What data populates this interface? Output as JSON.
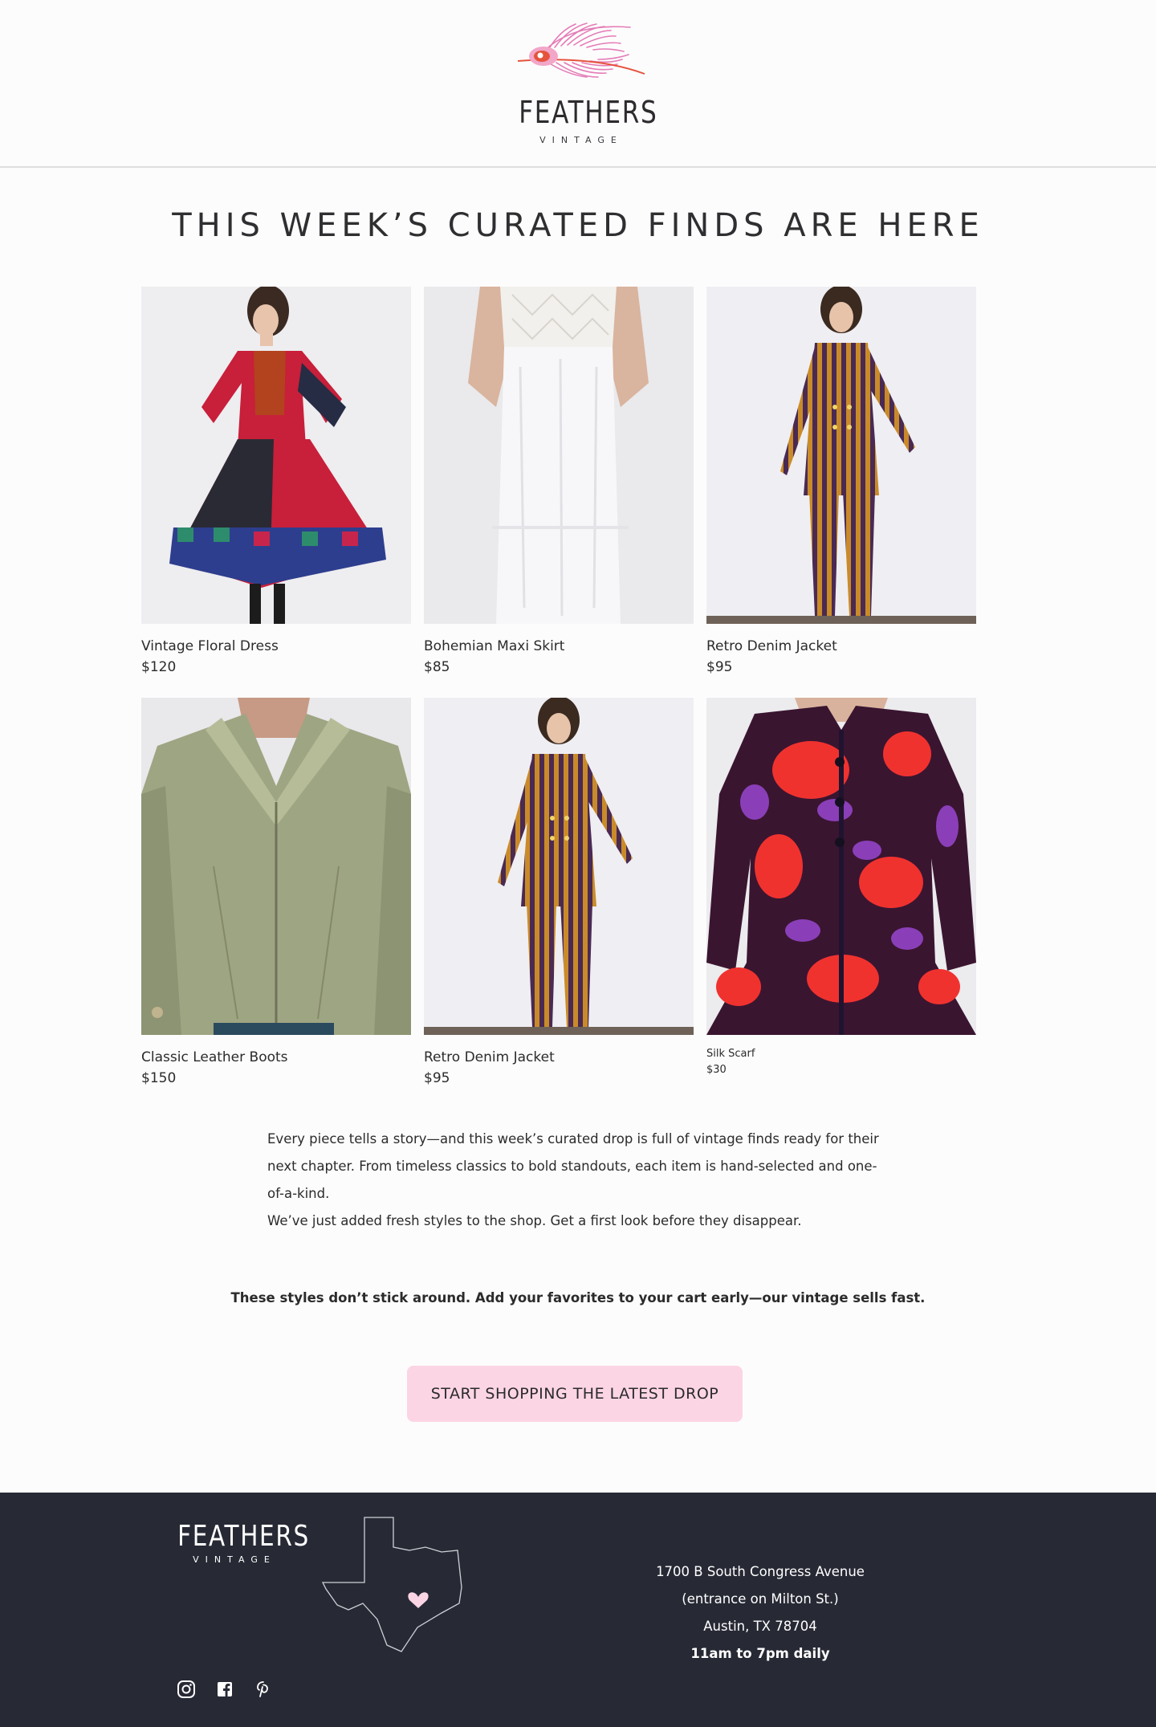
{
  "brand": {
    "name": "FEATHERS",
    "subtitle": "VINTAGE"
  },
  "headline": "THIS WEEK’S CURATED FINDS ARE HERE",
  "products": [
    {
      "name": "Vintage Floral Dress",
      "price": "$120",
      "image": "red-black-embroidered-dress-photo"
    },
    {
      "name": "Bohemian Maxi Skirt",
      "price": "$85",
      "image": "white-crochet-slip-dress-photo"
    },
    {
      "name": "Retro Denim Jacket",
      "price": "$95",
      "image": "striped-pantsuit-photo"
    },
    {
      "name": "Classic Leather Boots",
      "price": "$150",
      "image": "sage-suede-jacket-photo"
    },
    {
      "name": "Retro Denim Jacket",
      "price": "$95",
      "image": "striped-pantsuit-photo"
    },
    {
      "name": "Silk Scarf",
      "price": "$30",
      "image": "rose-print-knit-dress-photo"
    }
  ],
  "body": {
    "paragraph1": "Every piece tells a story—and this week’s curated drop is full of vintage finds ready for their next chapter. From timeless classics to bold standouts, each item is hand-selected and one-of-a-kind.",
    "paragraph2": "We’ve just added fresh styles to the shop. Get a first look before they disappear."
  },
  "urgency": "These styles don’t stick around. Add your favorites to your cart early—our vintage sells fast.",
  "cta_label": "START SHOPPING THE LATEST DROP",
  "colors": {
    "accent_pink": "#fcd5e5",
    "footer_bg": "#272a35",
    "feather_pink": "#e47bb6",
    "feather_red": "#e5533d"
  },
  "footer": {
    "brand_name": "FEATHERS",
    "brand_subtitle": "VINTAGE",
    "address_line1": "1700 B South Congress Avenue",
    "address_line2": "(entrance on Milton St.)",
    "address_line3": "Austin, TX 78704",
    "hours": "11am to 7pm daily",
    "social": [
      "instagram-icon",
      "facebook-icon",
      "pinterest-icon"
    ]
  }
}
